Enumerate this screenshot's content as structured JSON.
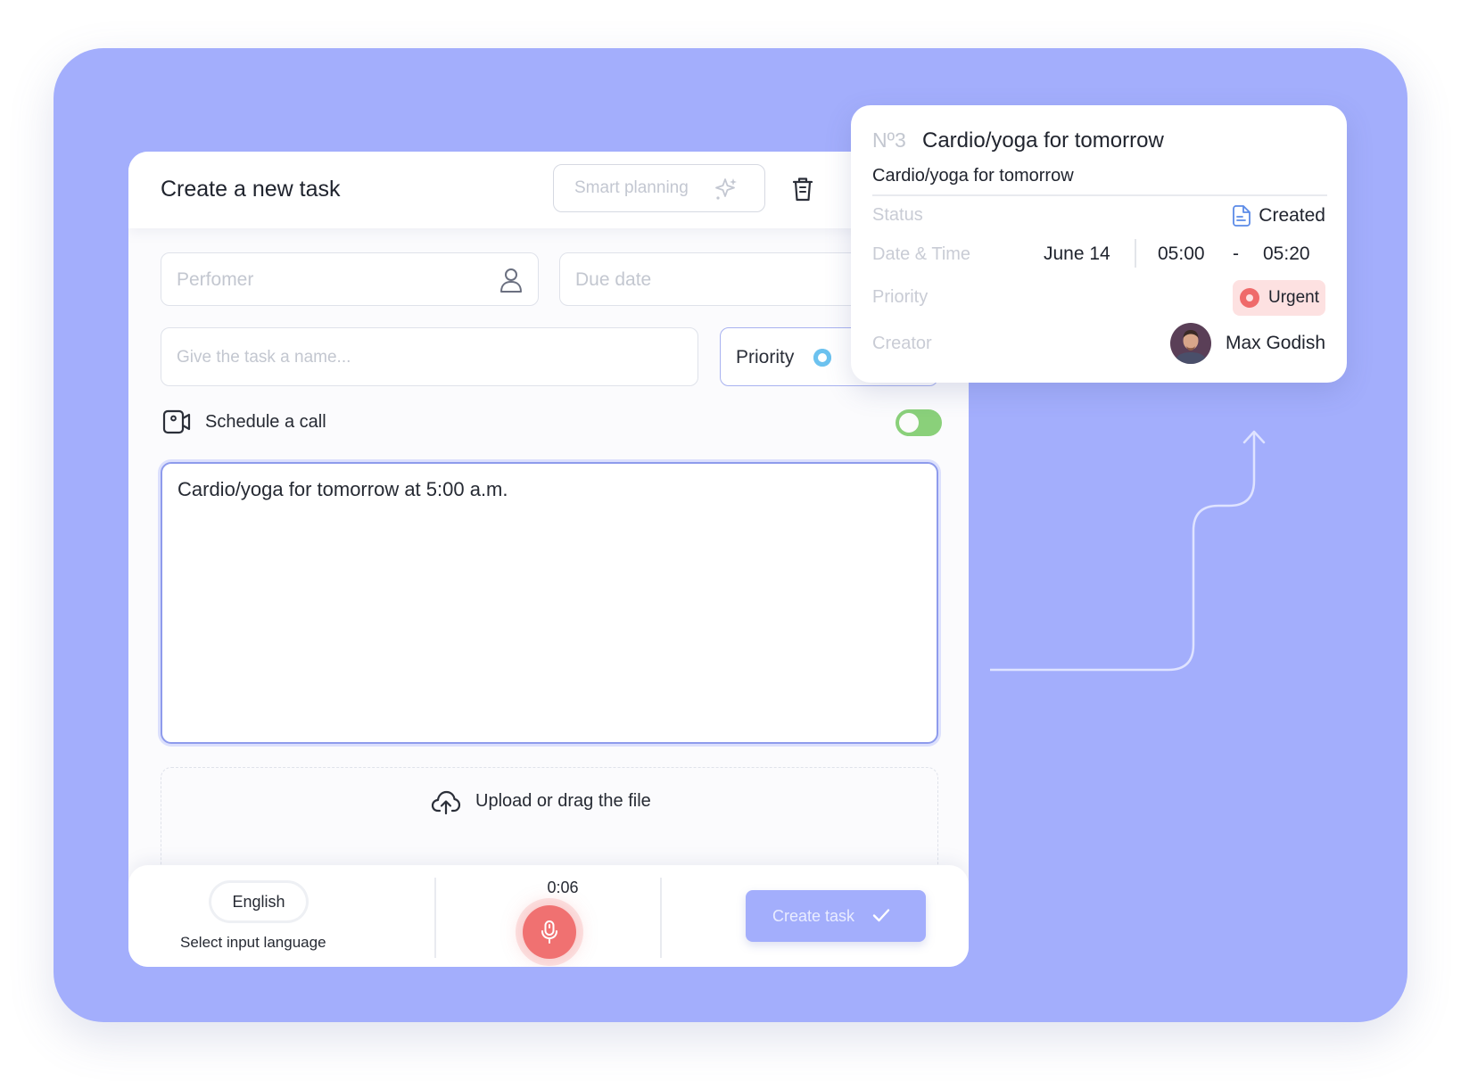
{
  "form": {
    "title": "Create a new task",
    "smart_planning_label": "Smart planning",
    "performer_placeholder": "Perfomer",
    "due_date_placeholder": "Due date",
    "name_placeholder": "Give the task a name...",
    "priority_label": "Priority",
    "schedule_call_label": "Schedule a call",
    "schedule_call_enabled": true,
    "description_value": "Cardio/yoga for tomorrow at 5:00 a.m.",
    "upload_label": "Upload or drag the file"
  },
  "footer": {
    "language": "English",
    "language_hint": "Select input language",
    "timer": "0:06",
    "create_label": "Create task"
  },
  "detail": {
    "number": "Nº3",
    "title": "Cardio/yoga for tomorrow",
    "subtitle": "Cardio/yoga for tomorrow",
    "status_label": "Status",
    "status_value": "Created",
    "datetime_label": "Date & Time",
    "date": "June 14",
    "time_start": "05:00",
    "time_dash": "-",
    "time_end": "05:20",
    "priority_label": "Priority",
    "priority_value": "Urgent",
    "creator_label": "Creator",
    "creator_name": "Max Godish"
  },
  "colors": {
    "background": "#a3aefc",
    "toggle_on": "#8ad07a",
    "mic": "#f07171",
    "urgent": "#ef6a6a",
    "priority_dot": "#6cc2ef"
  },
  "icons": [
    "sparkle-icon",
    "trash-icon",
    "user-icon",
    "video-call-icon",
    "cloud-upload-icon",
    "microphone-icon",
    "check-icon",
    "document-icon",
    "avatar"
  ]
}
